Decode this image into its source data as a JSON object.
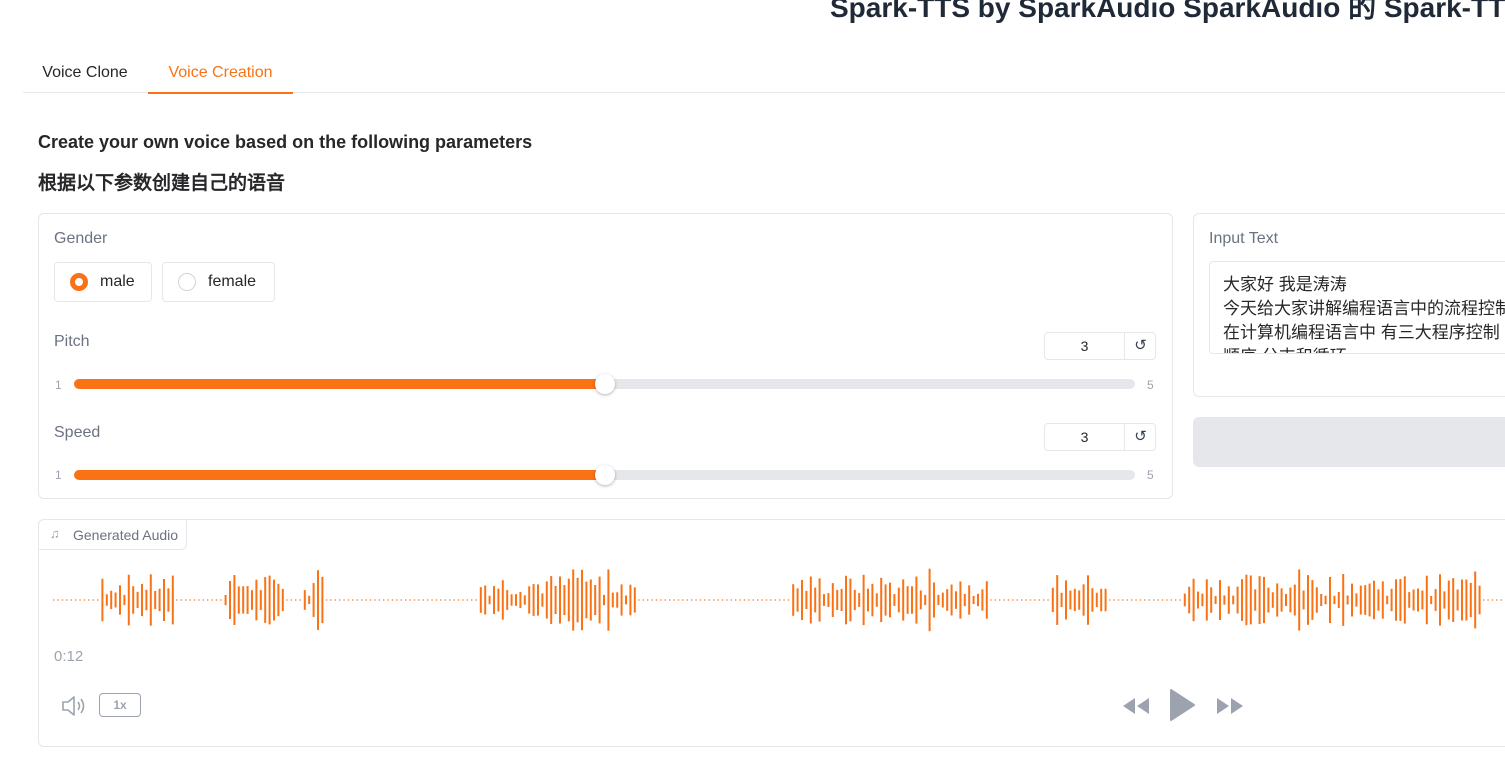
{
  "app": {
    "title": "Spark-TTS by SparkAudio SparkAudio 的 Spark-TTS"
  },
  "tabs": [
    {
      "label": "Voice Clone",
      "active": false
    },
    {
      "label": "Voice Creation",
      "active": true
    }
  ],
  "section": {
    "heading": "Create your own voice based on the following parameters",
    "heading_cn": "根据以下参数创建自己的语音"
  },
  "params": {
    "gender": {
      "label": "Gender",
      "options": [
        {
          "label": "male",
          "selected": true
        },
        {
          "label": "female",
          "selected": false
        }
      ]
    },
    "pitch": {
      "label": "Pitch",
      "value": "3",
      "min": "1",
      "max": "5",
      "level": 0.5
    },
    "speed": {
      "label": "Speed",
      "value": "3",
      "min": "1",
      "max": "5",
      "level": 0.5
    }
  },
  "input_text": {
    "label": "Input Text",
    "lines": [
      "大家好 我是涛涛",
      "今天给大家讲解编程语言中的流程控制",
      "在计算机编程语言中 有三大程序控制",
      "顺序 分支和循环"
    ]
  },
  "audio": {
    "label": "Generated Audio",
    "duration": "0:12",
    "playback_rate": "1x"
  },
  "colors": {
    "accent": "#f97316",
    "muted": "#9ca3af"
  },
  "icons": {
    "note": "music-note-icon",
    "reset": "reset-icon",
    "volume": "volume-icon",
    "rewind": "rewind-icon",
    "play": "play-icon",
    "forward": "fast-forward-icon"
  }
}
